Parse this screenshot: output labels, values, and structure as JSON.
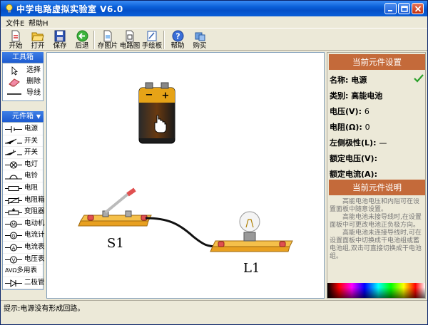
{
  "window": {
    "title": "中学电路虚拟实验室 V6.0",
    "colors": {
      "titlebar": "#0a5fd8",
      "header_orange": "#c46a3a",
      "panel_blue": "#1d5bd0"
    }
  },
  "menu": {
    "file": "文件E",
    "help": "帮助H"
  },
  "toolbar": {
    "new": "开始",
    "open": "打开",
    "save": "保存",
    "back": "后退",
    "save_image": "存图片",
    "circuit_diagram": "电路图",
    "sketchpad": "手绘板",
    "help": "帮助",
    "buy": "购买"
  },
  "toolbox": {
    "header": "工具箱",
    "items": [
      {
        "label": "选择",
        "icon": "cursor-icon"
      },
      {
        "label": "删除",
        "icon": "eraser-icon"
      },
      {
        "label": "导线",
        "icon": "wire-icon"
      }
    ]
  },
  "components": {
    "header": "元件箱",
    "items": [
      {
        "label": "电源",
        "icon": "battery-symbol-icon"
      },
      {
        "label": "开关",
        "icon": "switch-symbol-icon"
      },
      {
        "label": "开关",
        "icon": "switch2-symbol-icon"
      },
      {
        "label": "电灯",
        "icon": "lamp-symbol-icon"
      },
      {
        "label": "电铃",
        "icon": "bell-symbol-icon"
      },
      {
        "label": "电阻",
        "icon": "resistor-symbol-icon"
      },
      {
        "label": "电阻箱",
        "icon": "resistor-box-symbol-icon"
      },
      {
        "label": "变阻器",
        "icon": "rheostat-symbol-icon"
      },
      {
        "label": "电动机",
        "icon": "motor-symbol-icon"
      },
      {
        "label": "电流计",
        "icon": "galvanometer-symbol-icon"
      },
      {
        "label": "电流表",
        "icon": "ammeter-symbol-icon"
      },
      {
        "label": "电压表",
        "icon": "voltmeter-symbol-icon"
      },
      {
        "label": "多用表",
        "icon": "multimeter-symbol-icon",
        "prefix": "AVΩ"
      },
      {
        "label": "二极管",
        "icon": "diode-symbol-icon"
      }
    ]
  },
  "canvas": {
    "switch_label": "S1",
    "lamp_label": "L1"
  },
  "properties": {
    "header": "当前元件设置",
    "name_label": "名称:",
    "name_value": "电源",
    "type_label": "类别:",
    "type_value": "高能电池",
    "voltage_label": "电压(V):",
    "voltage_value": "6",
    "resistance_label": "电阻(Ω):",
    "resistance_value": "0",
    "polarity_label": "左侧极性(L):",
    "polarity_value": "—",
    "rated_voltage_label": "额定电压(V):",
    "rated_current_label": "额定电流(A):"
  },
  "description": {
    "header": "当前元件说明",
    "p1": "高能电池电压和内阻可在设置面板中随意设置。",
    "p2": "高能电池未接导线时,在设置面板中可更改电池正负极方向。",
    "p3": "高能电池未连接导线时,可在设置面板中切换成干电池组或蓄电池组,双击可直接切换成干电池组。"
  },
  "status": {
    "text": "提示:电源没有形成回路。"
  }
}
